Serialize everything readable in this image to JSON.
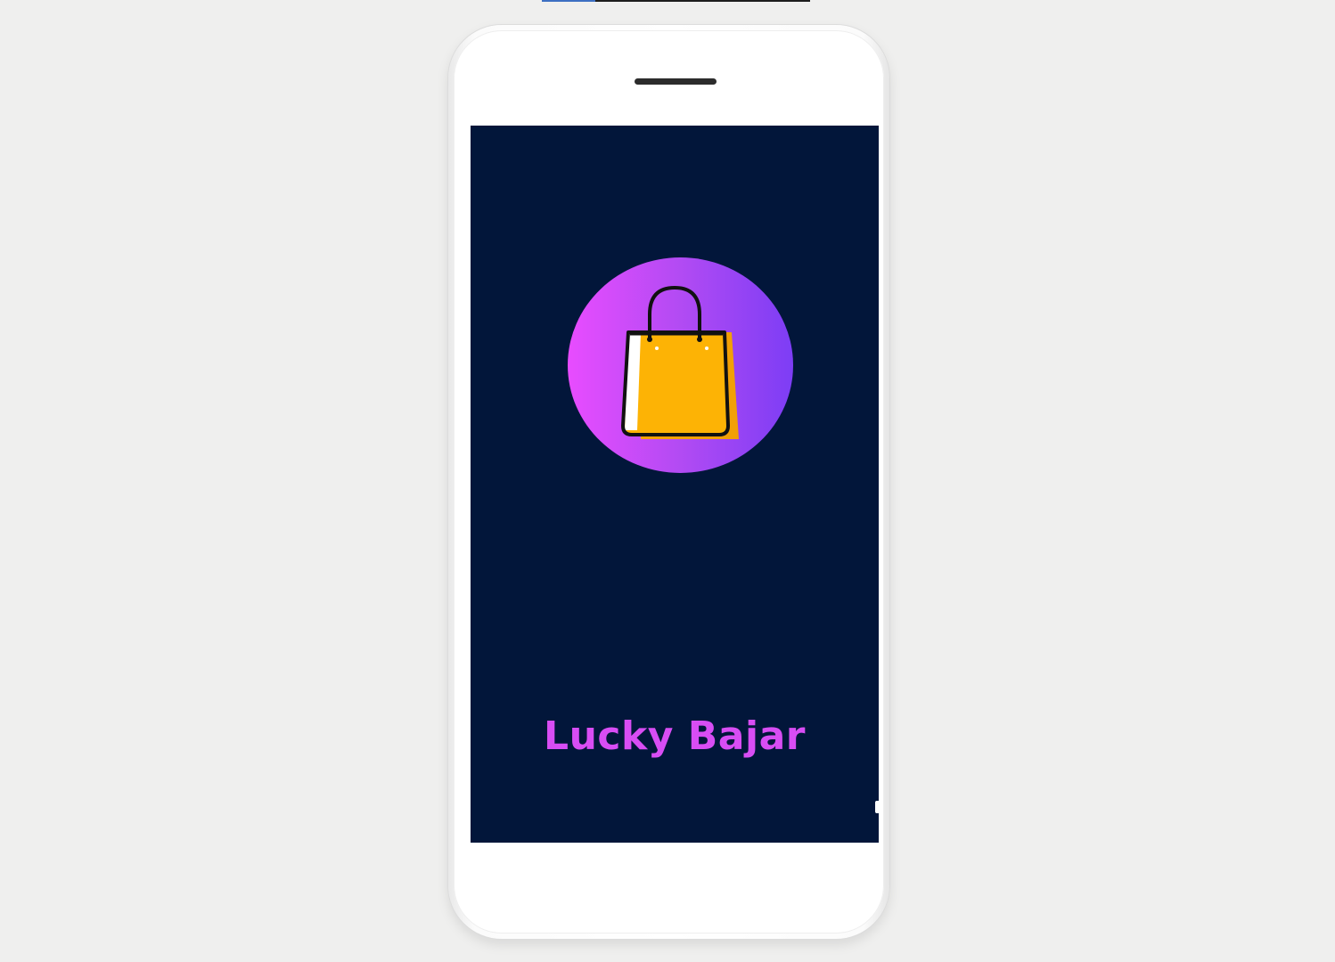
{
  "app": {
    "title": "Lucky Bajar"
  },
  "icons": {
    "logo": "shopping-bag-icon",
    "speaker": "speaker-grille"
  },
  "colors": {
    "page_background": "#efefee",
    "screen_background": "#02163a",
    "title_color": "#d84df4",
    "circle_gradient_start": "#e84cff",
    "circle_gradient_end": "#7d3df5",
    "bag_fill": "#fdb305",
    "bag_shadow": "#f2a006",
    "bag_outline": "#111111"
  }
}
